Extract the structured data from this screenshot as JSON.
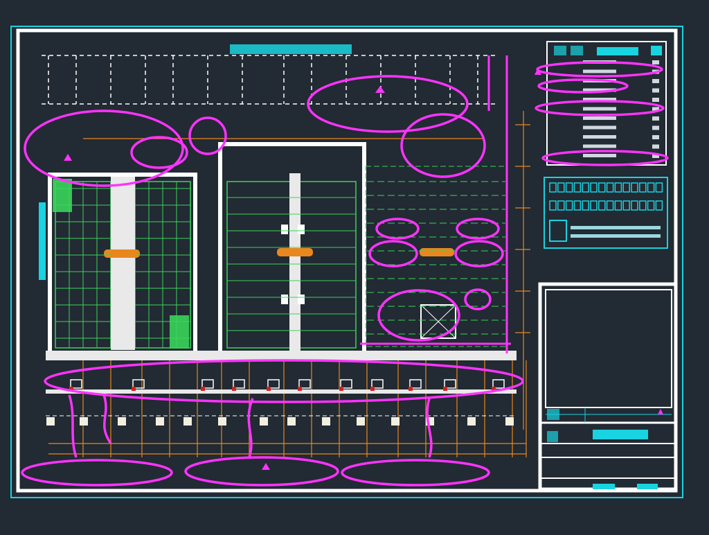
{
  "title_banner": "",
  "legend": {
    "rows": [
      "",
      "",
      "",
      "",
      "",
      "",
      "",
      "",
      "",
      "",
      ""
    ]
  },
  "notes": [
    "",
    ""
  ],
  "title_block": {
    "project": "",
    "sheet_title": "",
    "sheet_no": ""
  },
  "colors": {
    "background": "#222a33",
    "frame": "#ffffff",
    "cyan": "#19d3e0",
    "orange": "#e8871e",
    "green": "#39d45a",
    "magenta": "#ff33ff",
    "red": "#d62020"
  }
}
